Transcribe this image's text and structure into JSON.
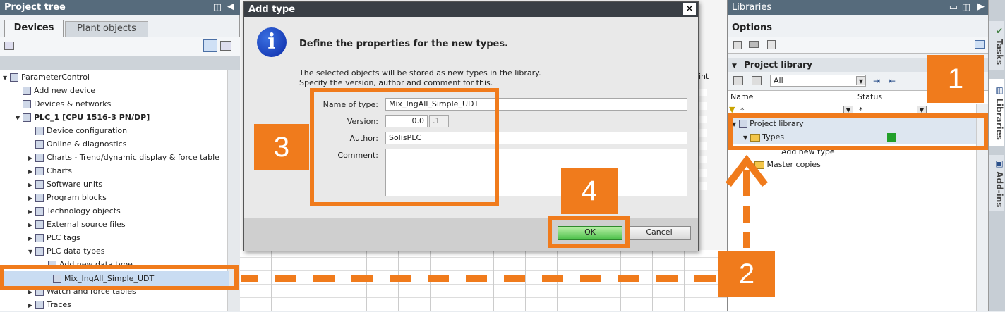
{
  "project_tree": {
    "title": "Project tree",
    "tabs": [
      "Devices",
      "Plant objects"
    ],
    "items": [
      {
        "label": "ParameterControl",
        "indent": 0,
        "arrow": "▼"
      },
      {
        "label": "Add new device",
        "indent": 1,
        "arrow": ""
      },
      {
        "label": "Devices & networks",
        "indent": 1,
        "arrow": ""
      },
      {
        "label": "PLC_1 [CPU 1516-3 PN/DP]",
        "indent": 1,
        "arrow": "▼",
        "bold": true
      },
      {
        "label": "Device configuration",
        "indent": 2,
        "arrow": ""
      },
      {
        "label": "Online & diagnostics",
        "indent": 2,
        "arrow": ""
      },
      {
        "label": "Charts - Trend/dynamic display & force table",
        "indent": 2,
        "arrow": "▶"
      },
      {
        "label": "Charts",
        "indent": 2,
        "arrow": "▶"
      },
      {
        "label": "Software units",
        "indent": 2,
        "arrow": "▶"
      },
      {
        "label": "Program blocks",
        "indent": 2,
        "arrow": "▶"
      },
      {
        "label": "Technology objects",
        "indent": 2,
        "arrow": "▶"
      },
      {
        "label": "External source files",
        "indent": 2,
        "arrow": "▶"
      },
      {
        "label": "PLC tags",
        "indent": 2,
        "arrow": "▶"
      },
      {
        "label": "PLC data types",
        "indent": 2,
        "arrow": "▼"
      },
      {
        "label": "Add new data type",
        "indent": 3,
        "arrow": ""
      },
      {
        "label": "Mix_IngAll_Simple_UDT",
        "indent": 3,
        "arrow": ""
      },
      {
        "label": "Watch and force tables",
        "indent": 2,
        "arrow": "▶"
      },
      {
        "label": "Traces",
        "indent": 2,
        "arrow": "▶"
      }
    ]
  },
  "middle": {
    "column_header": "int"
  },
  "dialog": {
    "title": "Add type",
    "heading": "Define the properties for the new types.",
    "desc_line1": "The selected objects will be stored as new types in the library.",
    "desc_line2": "Specify the version, author and comment for this.",
    "name_label": "Name of type:",
    "name_value": "Mix_IngAll_Simple_UDT",
    "version_label": "Version:",
    "version_major": "0.0",
    "version_minor": ".1",
    "author_label": "Author:",
    "author_value": "SolisPLC",
    "comment_label": "Comment:",
    "comment_value": "",
    "ok_label": "OK",
    "cancel_label": "Cancel"
  },
  "libraries": {
    "title": "Libraries",
    "options_label": "Options",
    "project_library_label": "Project library",
    "filter_value": "All",
    "col_name": "Name",
    "col_status": "Status",
    "filter_star": "*",
    "tree": [
      {
        "label": "Project library",
        "indent": 0
      },
      {
        "label": "Types",
        "indent": 1
      },
      {
        "label": "Add new type",
        "indent": 2
      },
      {
        "label": "Master copies",
        "indent": 1
      }
    ]
  },
  "side_tabs": [
    "Tasks",
    "Libraries",
    "Add-ins"
  ],
  "callouts": [
    "1",
    "2",
    "3",
    "4"
  ],
  "colors": {
    "accent": "#f07b1c",
    "titlebar": "#566b7c",
    "status_green": "#22a02a"
  }
}
